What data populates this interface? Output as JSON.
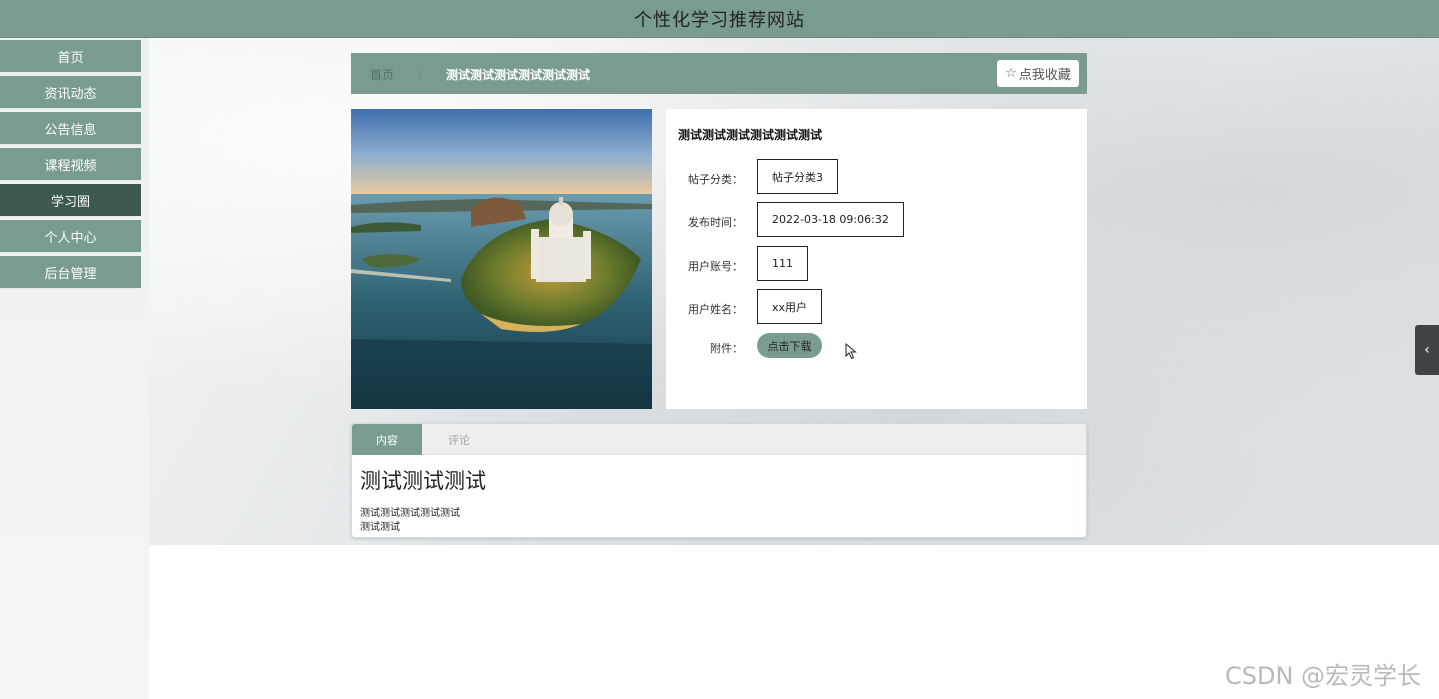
{
  "site": {
    "title": "个性化学习推荐网站"
  },
  "sidebar": {
    "items": [
      {
        "label": "首页"
      },
      {
        "label": "资讯动态"
      },
      {
        "label": "公告信息"
      },
      {
        "label": "课程视频"
      },
      {
        "label": "学习圈",
        "active": true
      },
      {
        "label": "个人中心"
      },
      {
        "label": "后台管理"
      }
    ]
  },
  "breadcrumb": {
    "home": "首页",
    "separator": "/",
    "current": "测试测试测试测试测试测试"
  },
  "favorite": {
    "icon": "star-outline-icon",
    "label": "点我收藏"
  },
  "post": {
    "title": "测试测试测试测试测试测试",
    "fields": [
      {
        "label": "帖子分类：",
        "value": "帖子分类3"
      },
      {
        "label": "发布时间：",
        "value": "2022-03-18 09:06:32"
      },
      {
        "label": "用户账号：",
        "value": "111"
      },
      {
        "label": "用户姓名：",
        "value": "xx用户"
      }
    ],
    "attachment": {
      "label": "附件：",
      "button": "点击下载"
    }
  },
  "tabs": [
    {
      "label": "内容",
      "active": true
    },
    {
      "label": "评论",
      "active": false
    }
  ],
  "content": {
    "heading": "测试测试测试",
    "lines": [
      "测试测试测试测试测试",
      "测试测试"
    ]
  },
  "side_toggle": {
    "icon": "chevron-left-icon",
    "glyph": "‹"
  },
  "watermark": "CSDN @宏灵学长",
  "colors": {
    "accent": "#7a9c90",
    "accent_dark": "#3c5a52"
  }
}
